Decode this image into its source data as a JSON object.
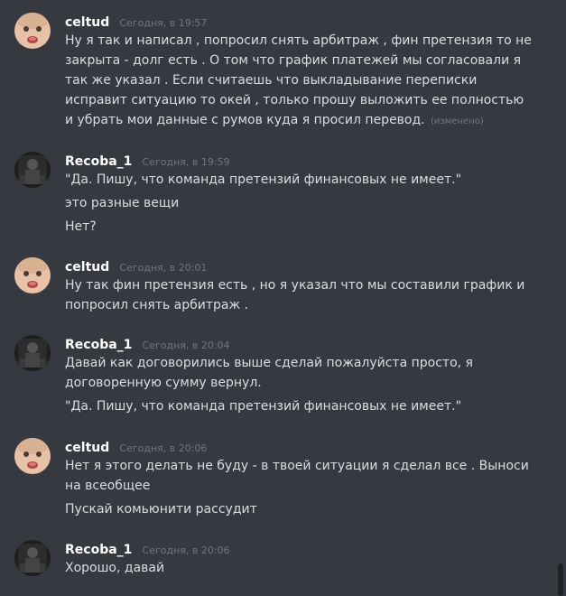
{
  "messages": [
    {
      "author": "celtud",
      "avatar": "baby-face-avatar",
      "time": "Сегодня, в 19:57",
      "lines": [
        "Ну я так и написал , попросил снять арбитраж , фин претензия то не закрыта - долг есть . О том что график платежей мы согласовали я так же указал . Если считаешь что выкладывание переписки исправит ситуацию то окей , только прошу выложить ее полностью и убрать мои данные с румов куда я просил перевод."
      ],
      "edited": "(изменено)"
    },
    {
      "author": "Recoba_1",
      "avatar": "dark-figure-avatar",
      "time": "Сегодня, в 19:59",
      "lines": [
        "\"Да. Пишу, что команда претензий финансовых не имеет.\"",
        "это разные вещи",
        "Нет?"
      ]
    },
    {
      "author": "celtud",
      "avatar": "baby-face-avatar",
      "time": "Сегодня, в 20:01",
      "lines": [
        "Ну так фин претензия  есть , но я указал что мы составили график и попросил снять арбитраж ."
      ]
    },
    {
      "author": "Recoba_1",
      "avatar": "dark-figure-avatar",
      "time": "Сегодня, в 20:04",
      "lines": [
        "Давай как договорились выше сделай пожалуйста просто, я договоренную сумму вернул.",
        "\"Да. Пишу, что команда претензий финансовых не имеет.\""
      ]
    },
    {
      "author": "celtud",
      "avatar": "baby-face-avatar",
      "time": "Сегодня, в 20:06",
      "lines": [
        "Нет я этого делать не буду - в твоей ситуации я сделал все . Выноси на всеобщее",
        "Пускай комьюнити рассудит"
      ]
    },
    {
      "author": "Recoba_1",
      "avatar": "dark-figure-avatar",
      "time": "Сегодня, в 20:06",
      "lines": [
        "Хорошо, давай"
      ]
    }
  ]
}
